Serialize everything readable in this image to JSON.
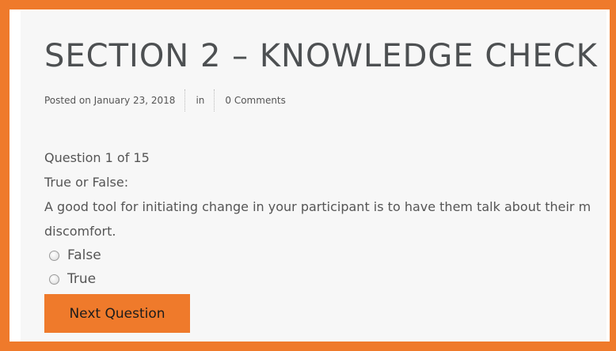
{
  "post": {
    "title": "SECTION 2 – KNOWLEDGE CHECK",
    "posted_on": "Posted on January 23, 2018",
    "in_label": "in",
    "comments": "0 Comments"
  },
  "quiz": {
    "progress": "Question 1 of 15",
    "question_type": "True or False:",
    "question_line1": "A good tool for initiating change in your participant is to have them talk about their m",
    "question_line2": "discomfort.",
    "options": [
      {
        "label": "False"
      },
      {
        "label": "True"
      }
    ],
    "next_button": "Next Question"
  },
  "colors": {
    "accent": "#ef7a2b",
    "title": "#4d5052",
    "text": "#555555",
    "panel": "#f7f7f7"
  }
}
